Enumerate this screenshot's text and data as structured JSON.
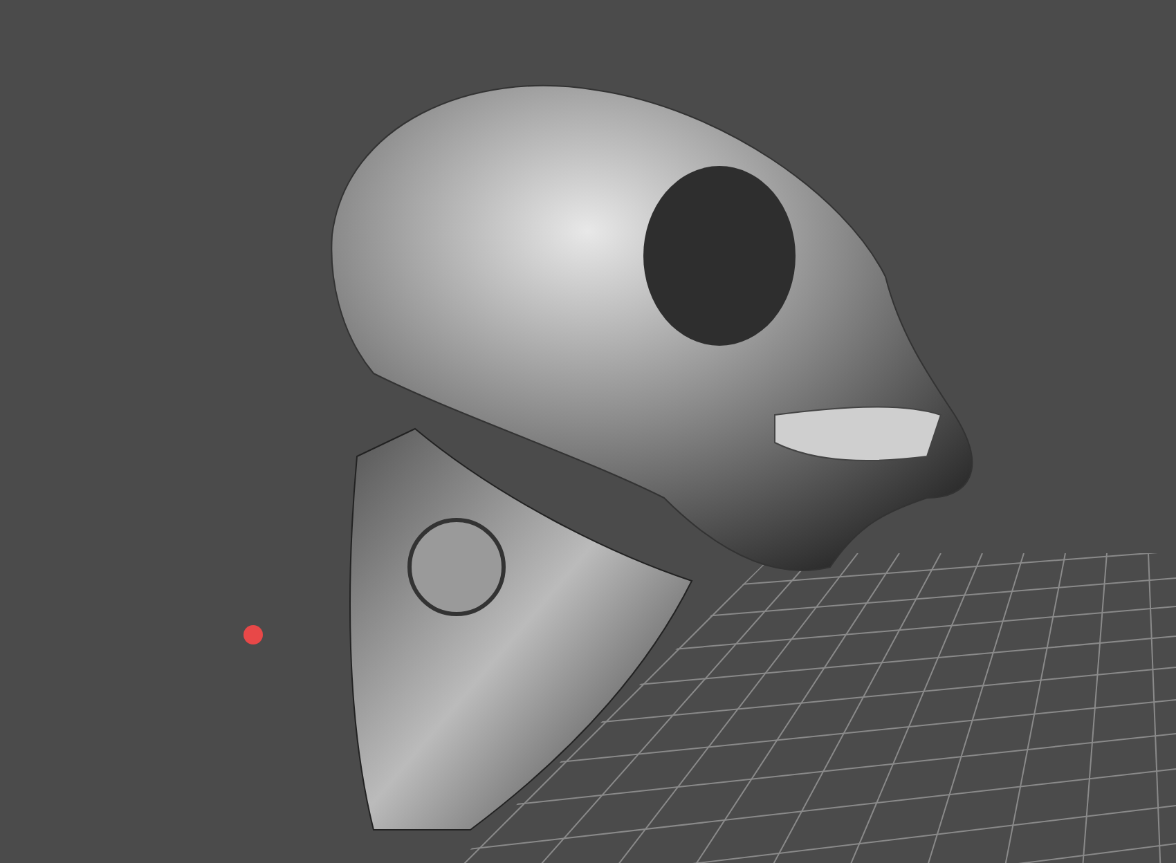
{
  "viewport": {
    "grid_visible": true,
    "pivot_marker_visible": true
  }
}
